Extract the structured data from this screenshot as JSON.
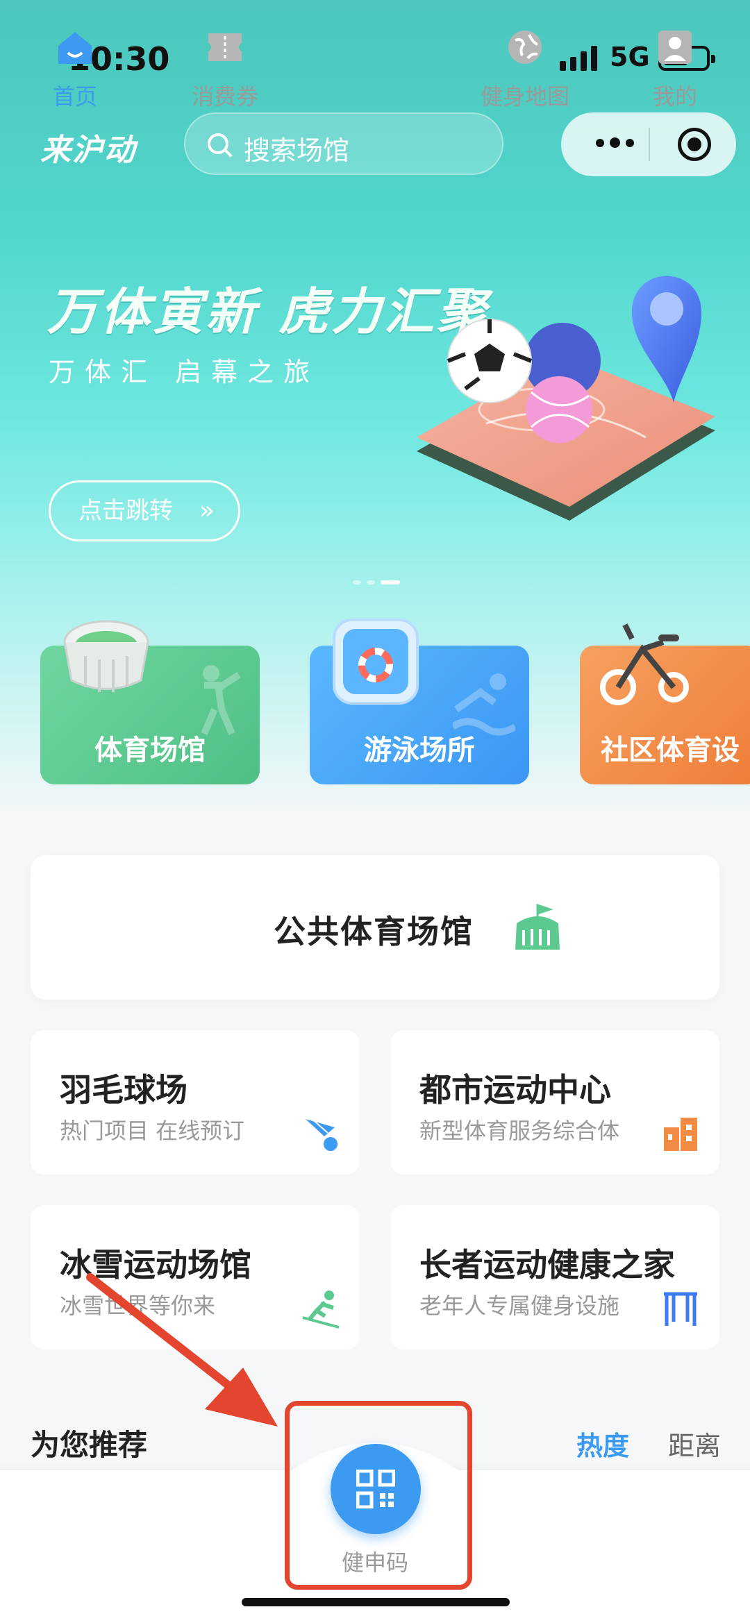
{
  "status_bar": {
    "time": "10:30",
    "network": "5G"
  },
  "header": {
    "logo": "来沪动",
    "search_placeholder": "搜索场馆"
  },
  "banner": {
    "title": "万体寅新  虎力汇聚",
    "subtitle": "万体汇 启幕之旅",
    "button": "点击跳转",
    "page_count": 3,
    "active_page": 3
  },
  "categories": [
    {
      "label": "体育场馆",
      "color": "#5cc990"
    },
    {
      "label": "游泳场所",
      "color": "#4aa8fa"
    },
    {
      "label": "社区体育设",
      "color": "#f28c45"
    }
  ],
  "public_venue": {
    "label": "公共体育场馆"
  },
  "tiles": [
    {
      "title": "羽毛球场",
      "subtitle": "热门项目 在线预订",
      "icon": "shuttlecock-icon"
    },
    {
      "title": "都市运动中心",
      "subtitle": "新型体育服务综合体",
      "icon": "building-icon"
    },
    {
      "title": "冰雪运动场馆",
      "subtitle": "冰雪世界等你来",
      "icon": "skier-icon"
    },
    {
      "title": "长者运动健康之家",
      "subtitle": "老年人专属健身设施",
      "icon": "bars-icon"
    }
  ],
  "recommend": {
    "title": "为您推荐",
    "sort_hot": "热度",
    "sort_distance": "距离",
    "active_sort": "热度"
  },
  "tabbar": {
    "items": [
      {
        "label": "首页",
        "icon": "home-icon",
        "active": true
      },
      {
        "label": "消费券",
        "icon": "ticket-icon",
        "active": false
      },
      {
        "label": "健申码",
        "icon": "qrcode-icon",
        "active": false
      },
      {
        "label": "健身地图",
        "icon": "globe-icon",
        "active": false
      },
      {
        "label": "我的",
        "icon": "user-icon",
        "active": false
      }
    ]
  },
  "colors": {
    "accent": "#3c9bf0",
    "highlight": "#e4452f",
    "hero": "#4cc6bc"
  }
}
